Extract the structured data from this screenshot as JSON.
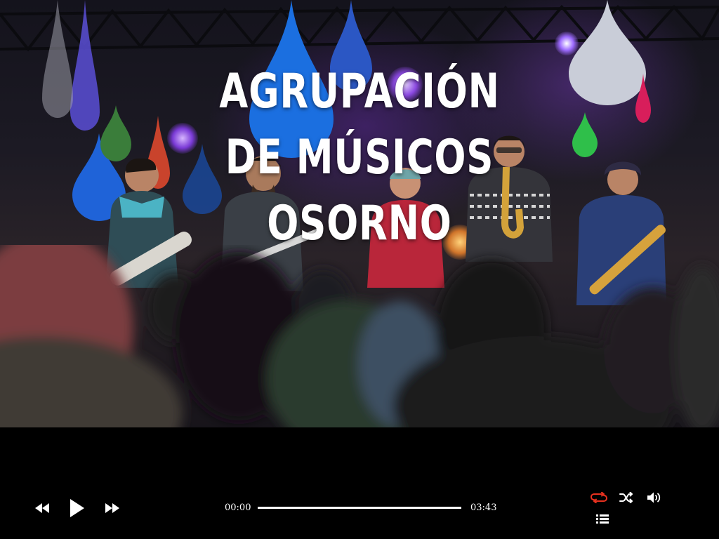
{
  "cover": {
    "title_lines": [
      "AGRUPACIÓN",
      "DE MÚSICOS",
      "OSORNO"
    ]
  },
  "player": {
    "current_time": "00:00",
    "duration": "03:43",
    "progress_fraction": 1.0,
    "repeat_active": true,
    "controls": {
      "rewind_icon": "rewind-icon",
      "play_icon": "play-icon",
      "forward_icon": "fast-forward-icon",
      "repeat_icon": "repeat-icon",
      "shuffle_icon": "shuffle-icon",
      "volume_icon": "volume-icon",
      "playlist_icon": "playlist-icon"
    }
  },
  "colors": {
    "background": "#000000",
    "control": "#ffffff",
    "accent_active": "#e8311f",
    "track": "#ffffff"
  }
}
